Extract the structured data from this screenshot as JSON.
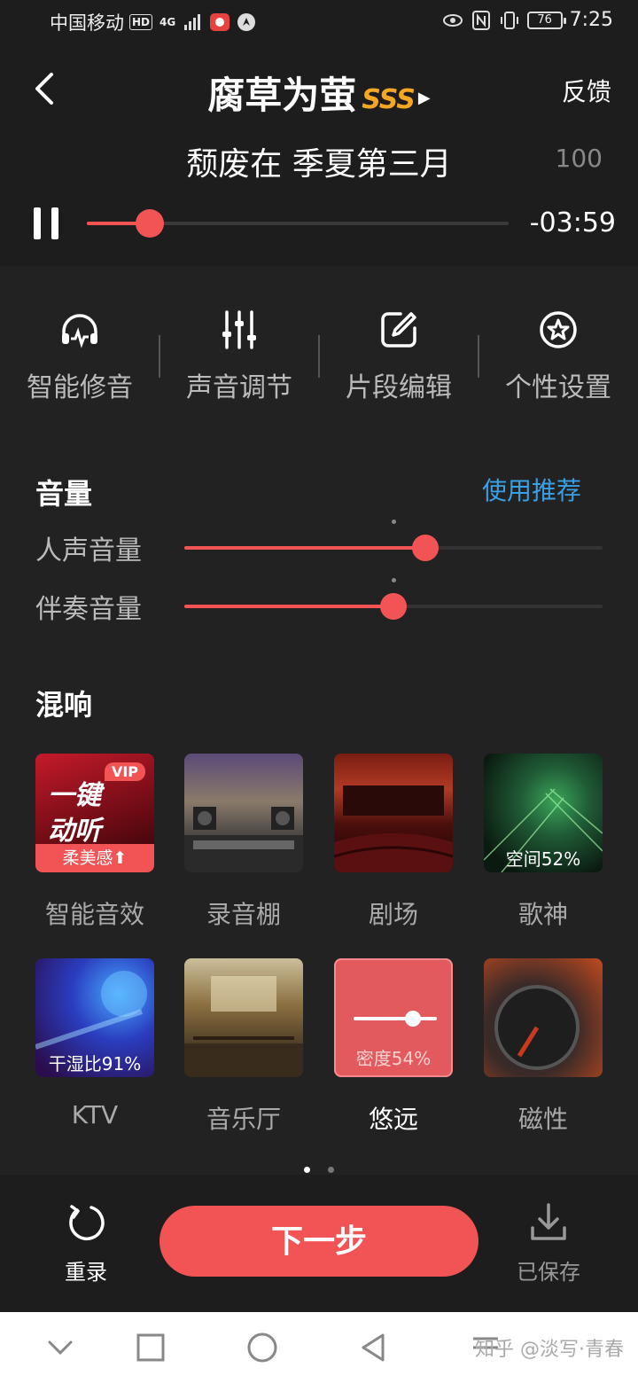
{
  "status_bar": {
    "carrier": "中国移动",
    "hd_badge": "HD",
    "network": "4G",
    "battery": "76",
    "time": "7:25"
  },
  "header": {
    "title": "腐草为萤",
    "title_tag": "SSS",
    "feedback_label": "反馈",
    "lyric": "颓废在 季夏第三月",
    "score": "100",
    "time_remaining": "-03:59",
    "progress": 0.15
  },
  "tools": [
    {
      "label": "智能修音",
      "icon": "headphone-wave-icon"
    },
    {
      "label": "声音调节",
      "icon": "equalizer-icon"
    },
    {
      "label": "片段编辑",
      "icon": "edit-icon"
    },
    {
      "label": "个性设置",
      "icon": "star-gear-icon"
    }
  ],
  "volume": {
    "title": "音量",
    "recommend_label": "使用推荐",
    "vocal_label": "人声音量",
    "vocal_level": 0.576,
    "vocal_default": 0.5,
    "accomp_label": "伴奏音量",
    "accomp_level": 0.5,
    "accomp_default": 0.5
  },
  "reverb": {
    "title": "混响",
    "row1": [
      {
        "label": "智能音效",
        "vip_text": "VIP",
        "thumb_text": "一键\n动听",
        "strip_text": "柔美感⬆"
      },
      {
        "label": "录音棚"
      },
      {
        "label": "剧场"
      },
      {
        "label": "歌神",
        "overlay": "空间52%"
      }
    ],
    "row2": [
      {
        "label": "KTV",
        "overlay": "干湿比91%"
      },
      {
        "label": "音乐厅"
      },
      {
        "label": "悠远",
        "overlay": "密度54%",
        "selected": true
      },
      {
        "label": "磁性"
      }
    ],
    "pages": 2,
    "current_page": 1
  },
  "actions": {
    "redo_label": "重录",
    "next_label": "下一步",
    "saved_label": "已保存"
  },
  "watermark": "知乎 @淡写·青春",
  "colors": {
    "accent": "#f25355",
    "link": "#3aa0e6",
    "tag": "#f5a623",
    "background": "#1d1d1d"
  }
}
